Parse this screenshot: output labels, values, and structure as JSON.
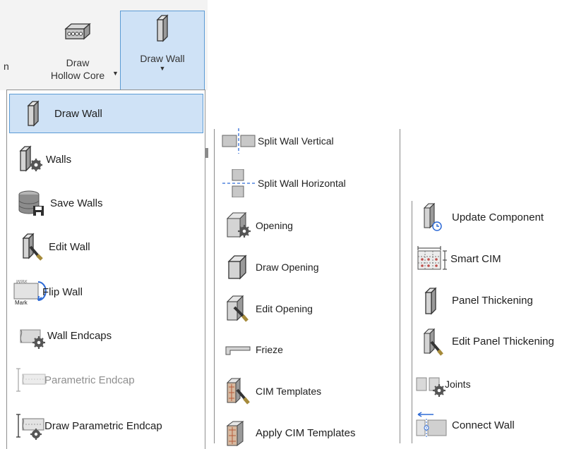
{
  "ribbon": {
    "left_edge_text": "n",
    "hollow_core_line1": "Draw",
    "hollow_core_line2": "Hollow Core",
    "draw_wall_label": "Draw Wall"
  },
  "menu_col1": [
    {
      "label": "Draw Wall",
      "icon": "wall-panel-icon",
      "selected": true
    },
    {
      "label": "Walls",
      "icon": "wall-gear-icon"
    },
    {
      "label": "Save Walls",
      "icon": "database-save-icon"
    },
    {
      "label": "Edit Wall",
      "icon": "wall-edit-icon"
    },
    {
      "label": "Flip Wall",
      "icon": "flip-wall-icon",
      "icon_text_top": "Mark",
      "icon_text_bottom": "Mark"
    },
    {
      "label": "Wall Endcaps",
      "icon": "endcap-gear-icon"
    },
    {
      "label": "Parametric Endcap",
      "icon": "parametric-endcap-icon",
      "disabled": true
    },
    {
      "label": "Draw Parametric Endcap",
      "icon": "draw-parametric-endcap-icon"
    }
  ],
  "menu_col2": [
    {
      "label": "Split Wall Vertical",
      "icon": "split-vertical-icon"
    },
    {
      "label": "Split Wall Horizontal",
      "icon": "split-horizontal-icon"
    },
    {
      "label": "Opening",
      "icon": "opening-gear-icon"
    },
    {
      "label": "Draw Opening",
      "icon": "draw-opening-icon"
    },
    {
      "label": "Edit Opening",
      "icon": "edit-opening-icon"
    },
    {
      "label": "Frieze",
      "icon": "frieze-icon"
    },
    {
      "label": "CIM Templates",
      "icon": "cim-templates-icon"
    },
    {
      "label": "Apply CIM Templates",
      "icon": "apply-cim-templates-icon"
    }
  ],
  "menu_col3": [
    {
      "label": "Update Component",
      "icon": "update-component-icon"
    },
    {
      "label": "Smart CIM",
      "icon": "smart-cim-icon"
    },
    {
      "label": "Panel Thickening",
      "icon": "panel-thickening-icon"
    },
    {
      "label": "Edit Panel Thickening",
      "icon": "edit-panel-thickening-icon"
    },
    {
      "label": "Joints",
      "icon": "joints-gear-icon"
    },
    {
      "label": "Connect Wall",
      "icon": "connect-wall-icon"
    }
  ],
  "colors": {
    "selected_bg": "#cfe2f6",
    "selected_border": "#5b9bd5",
    "ribbon_bg": "#f3f3f3",
    "disabled_text": "#8f8f8f"
  }
}
